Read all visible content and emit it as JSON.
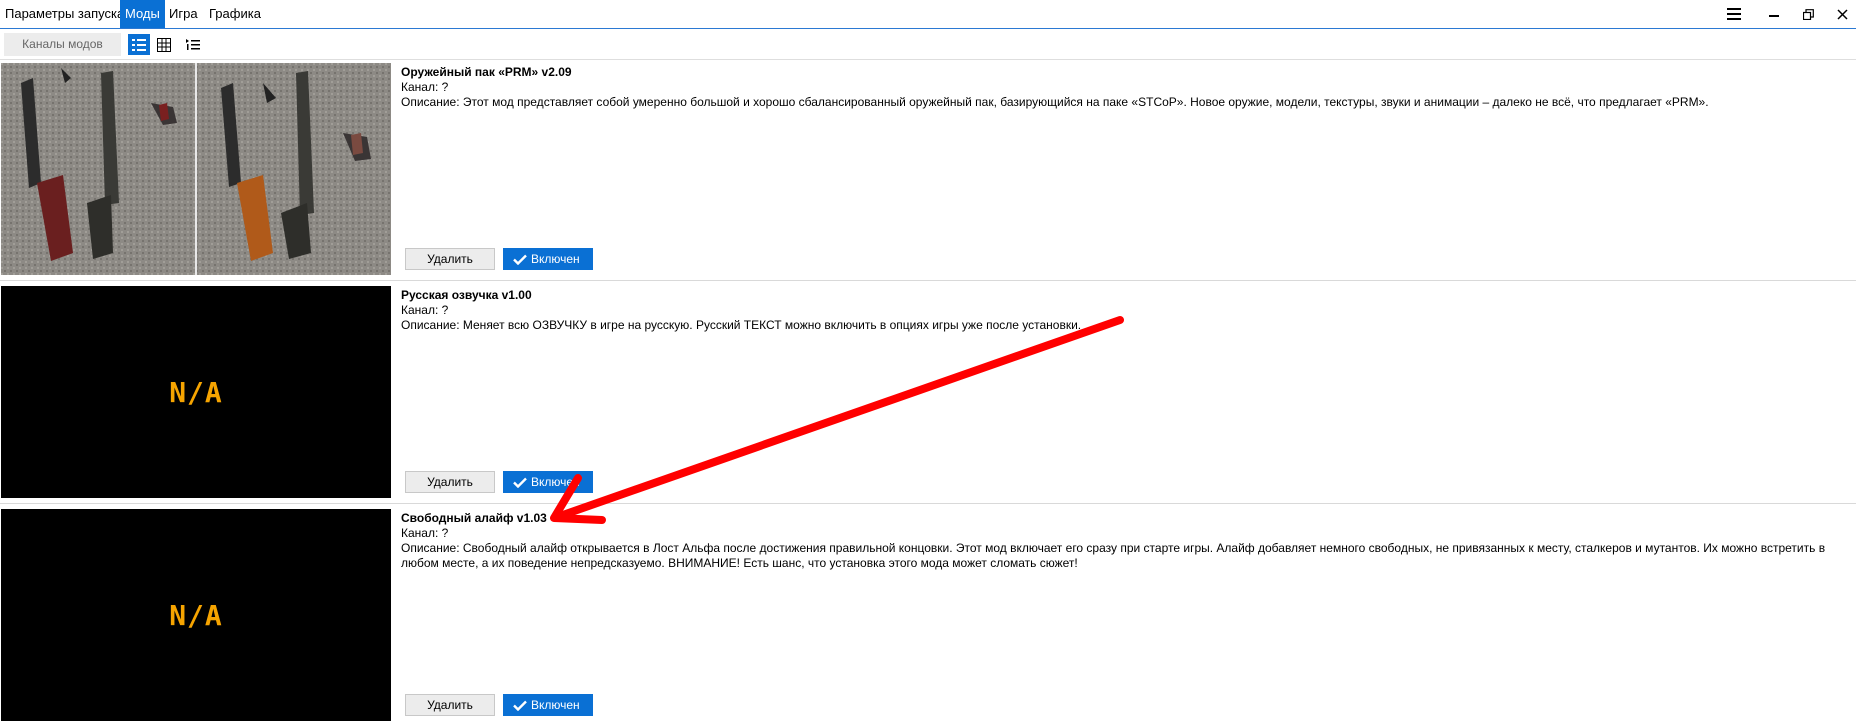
{
  "menu": {
    "items": [
      "Параметры запуска",
      "Моды",
      "Игра",
      "Графика"
    ],
    "active_index": 1
  },
  "window_controls": [
    "hamburger-icon",
    "minimize-icon",
    "restore-icon",
    "close-icon"
  ],
  "toolbar": {
    "channels_label": "Каналы модов",
    "views": [
      "list-view-icon",
      "grid-view-icon",
      "compact-list-icon"
    ],
    "active_view": 0
  },
  "colors": {
    "accent": "#0a70d4",
    "na_text": "#f6a400",
    "annotation_arrow": "#ff0000"
  },
  "mods": [
    {
      "title": "Оружейный пак «PRM» v2.09",
      "channel": "Канал: ?",
      "description": "Описание: Этот мод представляет собой умеренно большой и хорошо сбалансированный оружейный пак, базирующийся на паке «STCoP». Новое оружие, модели, текстуры, звуки и анимации – далеко не всё, что предлагает «PRM».",
      "preview": "weapons-photo",
      "delete_label": "Удалить",
      "enabled_label": "Включен"
    },
    {
      "title": "Русская озвучка v1.00",
      "channel": "Канал: ?",
      "description": "Описание: Меняет всю ОЗВУЧКУ в игре на русскую. Русский ТЕКСТ можно включить в опциях игры уже после установки.",
      "preview_text": "N/A",
      "delete_label": "Удалить",
      "enabled_label": "Включен"
    },
    {
      "title": "Свободный алайф v1.03",
      "channel": "Канал: ?",
      "description": "Описание: Свободный алайф открывается в Лост Альфа после достижения правильной концовки. Этот мод включает его сразу при старте игры. Алайф добавляет немного свободных, не привязанных к месту, сталкеров и мутантов. Их можно встретить в любом месте, а их поведение непредсказуемо. ВНИМАНИЕ! Есть шанс, что установка этого мода может сломать сюжет!",
      "preview_text": "N/A",
      "delete_label": "Удалить",
      "enabled_label": "Включен"
    }
  ]
}
